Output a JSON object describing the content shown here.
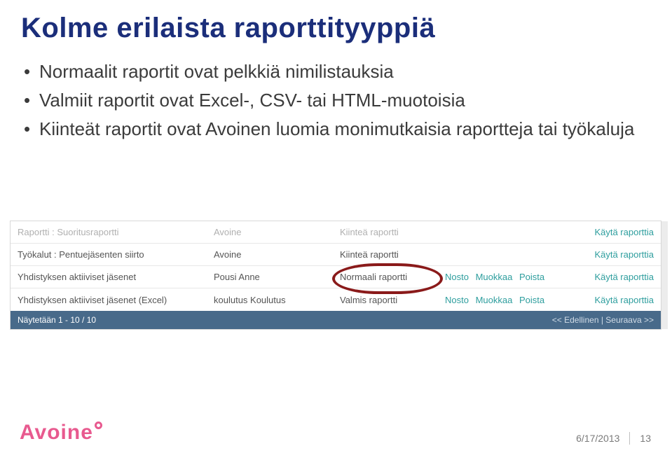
{
  "title": "Kolme erilaista raporttityyppiä",
  "bullets": [
    "Normaalit raportit ovat pelkkiä nimilistauksia",
    "Valmiit raportit ovat Excel-, CSV- tai HTML-muotoisia",
    "Kiinteät raportit ovat Avoinen luomia monimutkaisia raportteja tai työkaluja"
  ],
  "table": {
    "rows": [
      {
        "c1": "Raportti : Suoritusraportti",
        "c2": "Avoine",
        "c3": "Kiinteä raportti",
        "actions": [],
        "c5": "Käytä raporttia"
      },
      {
        "c1": "Työkalut : Pentuejäsenten siirto",
        "c2": "Avoine",
        "c3": "Kiinteä raportti",
        "actions": [],
        "c5": "Käytä raporttia"
      },
      {
        "c1": "Yhdistyksen aktiiviset jäsenet",
        "c2": "Pousi Anne",
        "c3": "Normaali raportti",
        "actions": [
          "Nosto",
          "Muokkaa",
          "Poista"
        ],
        "c5": "Käytä raporttia"
      },
      {
        "c1": "Yhdistyksen aktiiviset jäsenet (Excel)",
        "c2": "koulutus Koulutus",
        "c3": "Valmis raportti",
        "actions": [
          "Nosto",
          "Muokkaa",
          "Poista"
        ],
        "c5": "Käytä raporttia"
      }
    ],
    "footer_left": "Näytetään 1 - 10 / 10",
    "footer_right": "<< Edellinen | Seuraava >>"
  },
  "logo_text": "Avoine",
  "footer": {
    "date": "6/17/2013",
    "page": "13"
  }
}
